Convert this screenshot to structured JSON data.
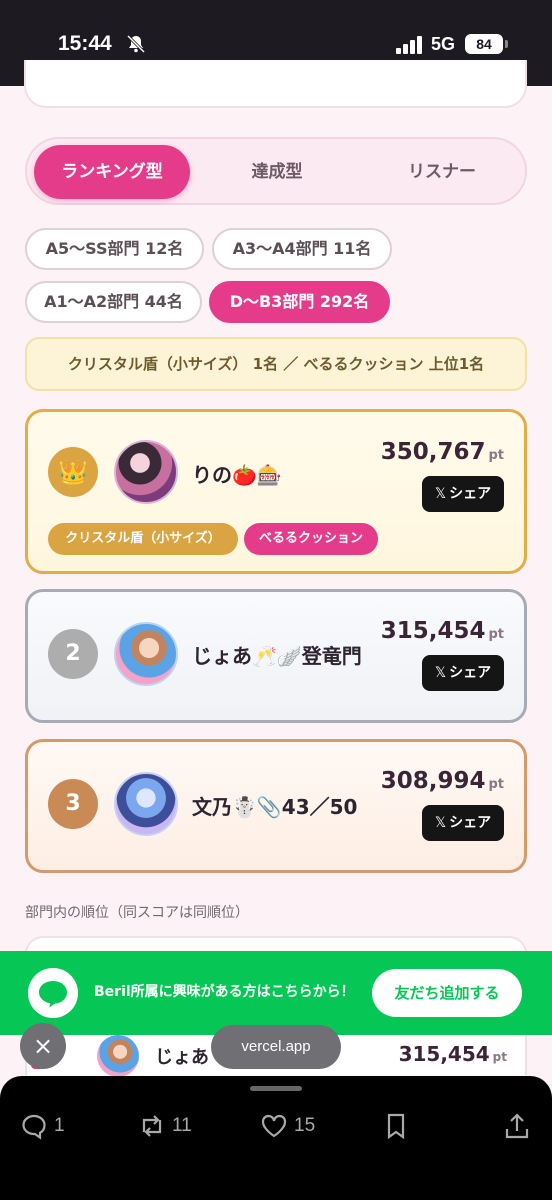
{
  "status": {
    "time": "15:44",
    "network": "5G",
    "battery": "84"
  },
  "tabs": [
    {
      "label": "ランキング型",
      "active": true
    },
    {
      "label": "達成型",
      "active": false
    },
    {
      "label": "リスナー",
      "active": false
    }
  ],
  "divisions": [
    {
      "label": "A5〜SS部門 12名",
      "active": false
    },
    {
      "label": "A3〜A4部門 11名",
      "active": false
    },
    {
      "label": "A1〜A2部門 44名",
      "active": false
    },
    {
      "label": "D〜B3部門 292名",
      "active": true
    }
  ],
  "prize_banner": "クリスタル盾（小サイズ） 1名 ／ べるるクッション 上位1名",
  "ranking": [
    {
      "rank_icon": "crown-icon",
      "name": "りの🍅🎰",
      "score": "350,767",
      "unit": "pt",
      "share": "シェア",
      "badges": [
        "クリスタル盾（小サイズ）",
        "べるるクッション"
      ]
    },
    {
      "rank": "2",
      "name": "じょあ🥂🪽登竜門",
      "score": "315,454",
      "unit": "pt",
      "share": "シェア"
    },
    {
      "rank": "3",
      "name": "文乃☃️📎43／50",
      "score": "308,994",
      "unit": "pt",
      "share": "シェア"
    }
  ],
  "note": "部門内の順位（同スコアは同順位）",
  "line_banner": {
    "text": "Beril所属に興味がある方はこちらから！",
    "button": "友だち追加する"
  },
  "list_row": {
    "name": "じょあ",
    "score": "315,454",
    "unit": "pt"
  },
  "browser": {
    "url": "vercel.app",
    "close": "×"
  },
  "toolbar": {
    "replies": "1",
    "reposts": "11",
    "likes": "15"
  },
  "colors": {
    "accent": "#e43c8a",
    "gold": "#e0ad47",
    "silver": "#a7abb3",
    "bronze": "#d49a6a",
    "line_green": "#06c755"
  }
}
